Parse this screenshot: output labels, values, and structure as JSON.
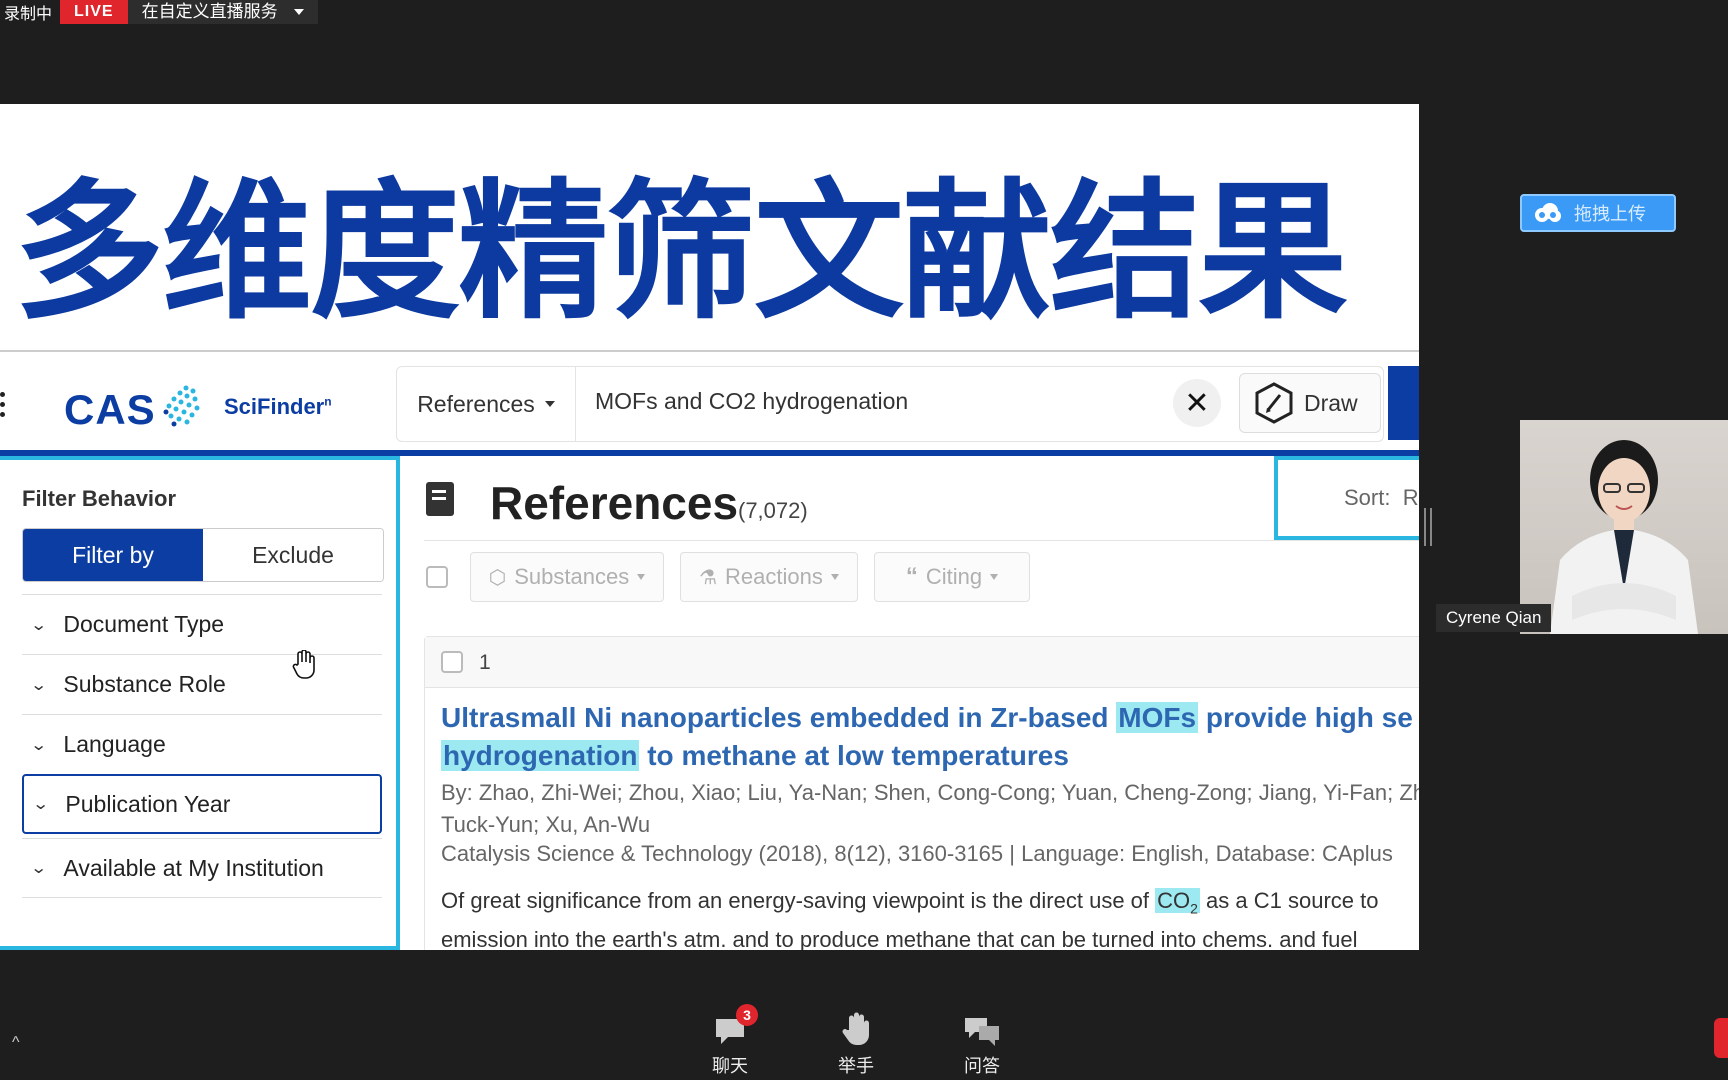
{
  "recording_bar": {
    "status": "录制中",
    "live": "LIVE",
    "stream_service": "在自定义直播服务"
  },
  "slide": {
    "title": "多维度精筛文献结果"
  },
  "scifinder": {
    "logo": "CAS",
    "product": "SciFinder",
    "product_sup": "n",
    "search_type": "References",
    "query": "MOFs and CO2 hydrogenation",
    "draw_label": "Draw"
  },
  "filters": {
    "behavior_title": "Filter Behavior",
    "filter_by": "Filter by",
    "exclude": "Exclude",
    "facets": [
      "Document Type",
      "Substance Role",
      "Language",
      "Publication Year",
      "Available at My Institution"
    ]
  },
  "results": {
    "title": "References",
    "count": "(7,072)",
    "sort_label": "Sort:",
    "sort_value": "R",
    "tools": [
      "Substances",
      "Reactions",
      "Citing"
    ],
    "first_result": {
      "index": "1",
      "title_part1": "Ultrasmall Ni nanoparticles embedded in Zr-based ",
      "title_hl1": "MOFs",
      "title_part2": " provide high se",
      "title_hl2": "hydrogenation",
      "title_part3": " to methane at low temperatures",
      "authors": "By: Zhao, Zhi-Wei; Zhou, Xiao; Liu, Ya-Nan; Shen, Cong-Cong; Yuan, Cheng-Zong; Jiang, Yi-Fan; Zh Tuck-Yun; Xu, An-Wu",
      "source": "Catalysis Science & Technology (2018), 8(12), 3160-3165 | Language: English, Database: CAplus",
      "abstract_part1": "Of great significance from an energy-saving viewpoint is the direct use of ",
      "abstract_hl": "CO",
      "abstract_hl_sub": "2",
      "abstract_part2": " as a C1 source to",
      "abstract_line2": "emission into the earth's atm. and to produce methane that can be turned into chems. and fuel"
    }
  },
  "sidebar_right": {
    "upload": "拖拽上传",
    "participant_name": "Cyrene Qian"
  },
  "bottom_toolbar": {
    "chat": "聊天",
    "chat_badge": "3",
    "raise_hand": "举手",
    "qa": "问答"
  },
  "colors": {
    "cas_blue": "#0c3da3",
    "highlight": "#9de9f1",
    "focus_cyan": "#29b6e0",
    "live_red": "#e0252d"
  }
}
